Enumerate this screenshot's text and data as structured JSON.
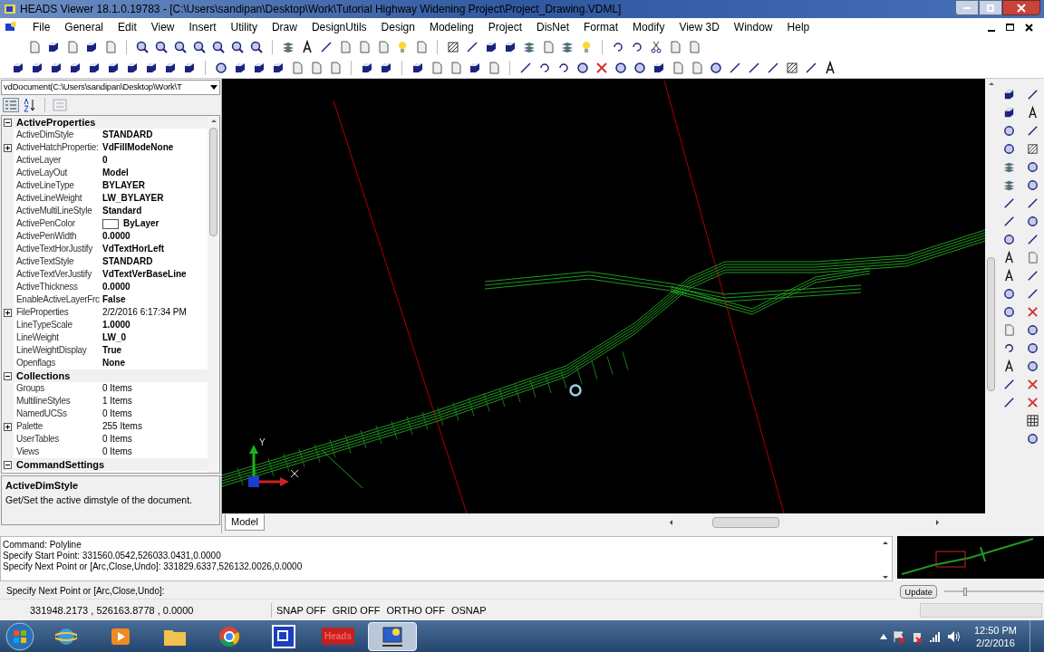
{
  "window": {
    "title": "HEADS Viewer 18.1.0.19783 - [C:\\Users\\sandipan\\Desktop\\Work\\Tutorial Highway Widening Project\\Project_Drawing.VDML]"
  },
  "menu": [
    "File",
    "General",
    "Edit",
    "View",
    "Insert",
    "Utility",
    "Draw",
    "DesignUtils",
    "Design",
    "Modeling",
    "Project",
    "DisNet",
    "Format",
    "Modify",
    "View 3D",
    "Window",
    "Help"
  ],
  "properties": {
    "document": "vdDocument(C:\\Users\\sandipan\\Desktop\\Work\\T",
    "categories": [
      {
        "name": "ActiveProperties",
        "expanded": true,
        "rows": [
          {
            "name": "ActiveDimStyle",
            "value": "STANDARD",
            "bold": true,
            "expandable": false,
            "kind": "text"
          },
          {
            "name": "ActiveHatchPropertie:",
            "value": "VdFillModeNone",
            "bold": true,
            "expandable": true,
            "kind": "text"
          },
          {
            "name": "ActiveLayer",
            "value": "0",
            "bold": true,
            "expandable": false,
            "kind": "text"
          },
          {
            "name": "ActiveLayOut",
            "value": "Model",
            "bold": true,
            "expandable": false,
            "kind": "text"
          },
          {
            "name": "ActiveLineType",
            "value": "BYLAYER",
            "bold": true,
            "expandable": false,
            "kind": "text"
          },
          {
            "name": "ActiveLineWeight",
            "value": "LW_BYLAYER",
            "bold": true,
            "expandable": false,
            "kind": "text"
          },
          {
            "name": "ActiveMultiLineStyle",
            "value": "Standard",
            "bold": true,
            "expandable": false,
            "kind": "text"
          },
          {
            "name": "ActivePenColor",
            "value": "ByLayer",
            "bold": true,
            "expandable": false,
            "kind": "swatch",
            "color": "#ffffff"
          },
          {
            "name": "ActivePenWidth",
            "value": "0.0000",
            "bold": true,
            "expandable": false,
            "kind": "text"
          },
          {
            "name": "ActiveTextHorJustify",
            "value": "VdTextHorLeft",
            "bold": true,
            "expandable": false,
            "kind": "text"
          },
          {
            "name": "ActiveTextStyle",
            "value": "STANDARD",
            "bold": true,
            "expandable": false,
            "kind": "text"
          },
          {
            "name": "ActiveTextVerJustify",
            "value": "VdTextVerBaseLine",
            "bold": true,
            "expandable": false,
            "kind": "text"
          },
          {
            "name": "ActiveThickness",
            "value": "0.0000",
            "bold": true,
            "expandable": false,
            "kind": "text"
          },
          {
            "name": "EnableActiveLayerFrc",
            "value": "False",
            "bold": true,
            "expandable": false,
            "kind": "text"
          },
          {
            "name": "FileProperties",
            "value": "2/2/2016 6:17:34 PM",
            "bold": false,
            "expandable": true,
            "kind": "text"
          },
          {
            "name": "LineTypeScale",
            "value": "1.0000",
            "bold": true,
            "expandable": false,
            "kind": "text"
          },
          {
            "name": "LineWeight",
            "value": "LW_0",
            "bold": true,
            "expandable": false,
            "kind": "text"
          },
          {
            "name": "LineWeightDisplay",
            "value": "True",
            "bold": true,
            "expandable": false,
            "kind": "text"
          },
          {
            "name": "Openflags",
            "value": "None",
            "bold": true,
            "expandable": false,
            "kind": "text"
          }
        ]
      },
      {
        "name": "Collections",
        "expanded": true,
        "rows": [
          {
            "name": "Groups",
            "value": "0 Items",
            "bold": false,
            "expandable": false,
            "kind": "text"
          },
          {
            "name": "MultilineStyles",
            "value": "1 Items",
            "bold": false,
            "expandable": false,
            "kind": "text"
          },
          {
            "name": "NamedUCSs",
            "value": "0 Items",
            "bold": false,
            "expandable": false,
            "kind": "text"
          },
          {
            "name": "Palette",
            "value": "255 Items",
            "bold": false,
            "expandable": true,
            "kind": "text"
          },
          {
            "name": "UserTables",
            "value": "0 Items",
            "bold": false,
            "expandable": false,
            "kind": "text"
          },
          {
            "name": "Views",
            "value": "0 Items",
            "bold": false,
            "expandable": false,
            "kind": "text"
          }
        ]
      },
      {
        "name": "CommandSettings",
        "expanded": true
      }
    ],
    "help": {
      "title": "ActiveDimStyle",
      "description": "Get/Set the active dimstyle of the document."
    }
  },
  "canvas": {
    "axis_label": "Y",
    "tabs": [
      {
        "label": "Model",
        "selected": true
      }
    ]
  },
  "command": {
    "lines": [
      "Command: Polyline",
      "Specify Start Point: 331560.0542,526033.0431,0.0000",
      "Specify Next Point or [Arc,Close,Undo]: 331829.6337,526132.0026,0.0000"
    ],
    "prompt": "Specify Next Point or [Arc,Close,Undo]:"
  },
  "preview": {
    "button": "Update",
    "zoom": {
      "level": 0.2
    }
  },
  "status_bar": {
    "coordinates": "331948.2173 , 526163.8778 , 0.0000",
    "toggles": [
      "SNAP OFF",
      "GRID OFF",
      "ORTHO OFF",
      "OSNAP"
    ]
  },
  "taskbar": {
    "apps": [
      {
        "kind": "browser-e",
        "active": false
      },
      {
        "kind": "media",
        "active": false
      },
      {
        "kind": "folder",
        "active": false
      },
      {
        "kind": "chrome",
        "active": false
      },
      {
        "kind": "window",
        "active": false
      },
      {
        "kind": "heads",
        "label": "Heads",
        "active": false
      },
      {
        "kind": "viewer",
        "active": true
      }
    ],
    "time": "12:50 PM",
    "date": "2/2/2016"
  }
}
